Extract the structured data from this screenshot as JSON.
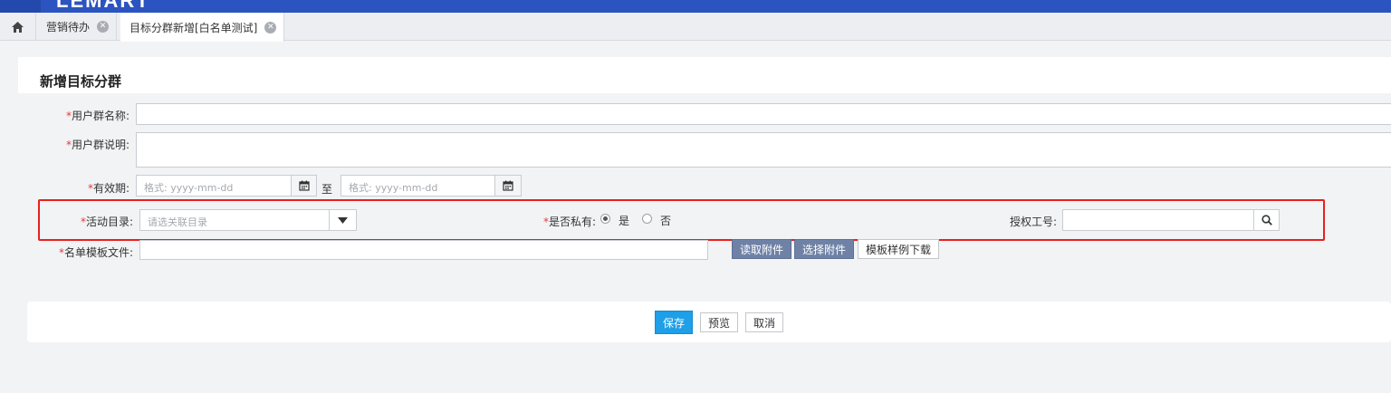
{
  "app": {
    "logo_text": "LEMART"
  },
  "tabs": [
    {
      "label": "营销待办"
    },
    {
      "label": "目标分群新增[白名单测试]"
    }
  ],
  "form": {
    "title": "新增目标分群",
    "required_mark": "*",
    "group_name": {
      "label": "用户群名称:",
      "value": ""
    },
    "group_desc": {
      "label": "用户群说明:",
      "value": ""
    },
    "validity": {
      "label": "有效期:",
      "start_placeholder": "格式: yyyy-mm-dd",
      "to_label": "至",
      "end_placeholder": "格式: yyyy-mm-dd"
    },
    "activity_catalog": {
      "label": "活动目录:",
      "placeholder": "请选关联目录"
    },
    "is_private": {
      "label": "是否私有:",
      "yes": "是",
      "no": "否",
      "selected": "是"
    },
    "auth_id": {
      "label": "授权工号:",
      "value": ""
    },
    "template_file": {
      "label": "名单模板文件:",
      "value": ""
    },
    "buttons": {
      "read_attachment": "读取附件",
      "select_attachment": "选择附件",
      "download_sample": "模板样例下载"
    }
  },
  "footer": {
    "save": "保存",
    "preview": "预览",
    "cancel": "取消"
  },
  "colors": {
    "brand": "#2c54c0",
    "primary": "#1e9fe8",
    "highlight": "#e8201d",
    "required": "#e23c3c"
  },
  "icons": [
    "home-icon",
    "close-circle-icon",
    "calendar-icon",
    "caret-down-icon",
    "search-icon"
  ]
}
